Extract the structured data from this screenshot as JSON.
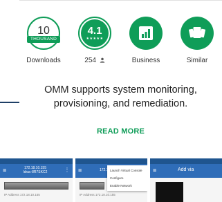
{
  "stats": {
    "downloads": {
      "number": "10",
      "band": "THOUSAND",
      "caption": "Downloads"
    },
    "rating": {
      "value": "4.1",
      "stars": "★★★★★",
      "caption": "254",
      "caption_icon": "person-icon"
    },
    "category": {
      "caption": "Business",
      "icon": "business-chart-icon"
    },
    "similar": {
      "caption": "Similar",
      "icon": "cards-icon"
    }
  },
  "description": "OMM supports system monitoring, provisioning, and remediation.",
  "read_more": "READ MORE",
  "screenshots": [
    {
      "title": "172.18.10.155\nldrac-8R7SKC2",
      "rows": [
        "IP Address   172.18.10.155"
      ]
    },
    {
      "title": "172.18.10.155",
      "menu": [
        "Launch Virtual Console",
        "Configure",
        "Enable Network"
      ],
      "rows": [
        "IP Address   172.18.10.155"
      ]
    },
    {
      "title": "Add via"
    }
  ],
  "colors": {
    "accent": "#0f9d58",
    "brand_blue": "#2f6db8"
  }
}
